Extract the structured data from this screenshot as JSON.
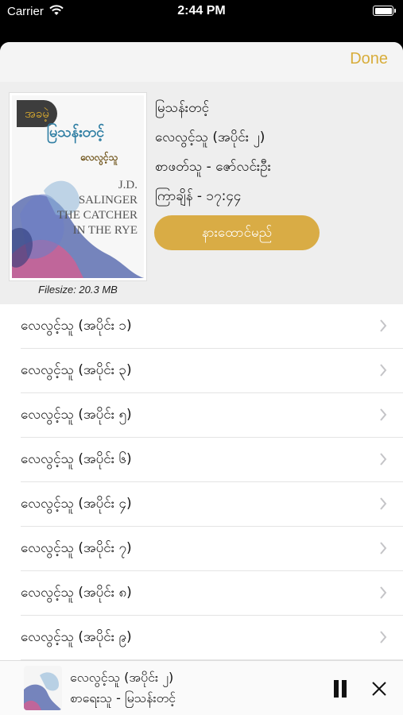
{
  "status": {
    "carrier": "Carrier",
    "time": "2:44 PM"
  },
  "nav": {
    "done_label": "Done"
  },
  "book": {
    "badge": "အခမဲ့",
    "cover_title": "မြသန်းတင့်",
    "cover_subtitle": "လေလွင့်သူ",
    "cover_author_lines": [
      "J.D.",
      "SALINGER",
      "THE CATCHER",
      "IN THE RYE"
    ],
    "filesize": "Filesize: 20.3 MB",
    "title": "မြသန်းတင့်",
    "episode": "လေလွင့်သူ (အပိုင်း ၂)",
    "narrator": "စာဖတ်သူ - ဇော်လင်းဦး",
    "duration": "ကြာချိန် - ၁၇:၄၄",
    "listen_label": "နားထောင်မည်"
  },
  "episodes": [
    {
      "label": "လေလွင့်သူ (အပိုင်း ၁)"
    },
    {
      "label": "လေလွင့်သူ (အပိုင်း ၃)"
    },
    {
      "label": "လေလွင့်သူ (အပိုင်း ၅)"
    },
    {
      "label": "လေလွင့်သူ (အပိုင်း ၆)"
    },
    {
      "label": "လေလွင့်သူ (အပိုင်း ၄)"
    },
    {
      "label": "လေလွင့်သူ (အပိုင်း ၇)"
    },
    {
      "label": "လေလွင့်သူ (အပိုင်း ၈)"
    },
    {
      "label": "လေလွင့်သူ (အပိုင်း ၉)"
    }
  ],
  "player": {
    "title": "လေလွင့်သူ (အပိုင်း ၂)",
    "author": "စာရေးသူ - မြသန်းတင့်"
  },
  "colors": {
    "accent": "#d8ad3b",
    "button": "#d9ac45",
    "badge_bg": "#3d3d3d"
  },
  "icons": [
    "wifi-icon",
    "battery-icon",
    "chevron-right-icon",
    "pause-icon",
    "close-icon"
  ]
}
